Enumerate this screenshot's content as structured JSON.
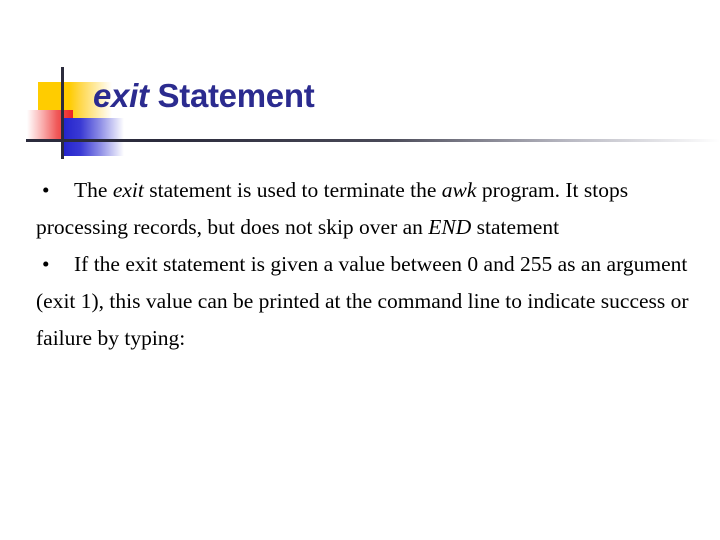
{
  "slide": {
    "background_color": "#ffffff",
    "title": {
      "keyword": "exit",
      "rest": " Statement",
      "color": "#2b2b8f"
    },
    "decoration": {
      "yellow_square_color": "#ffcc00",
      "red_square_color": "#ee2222",
      "blue_square_color": "#2222cc",
      "rule_color": "#2b2b3c"
    },
    "bullets": [
      {
        "marker": "•",
        "segments": [
          {
            "text": "The ",
            "style": "normal"
          },
          {
            "text": "exit",
            "style": "italic"
          },
          {
            "text": " statement is used to terminate the ",
            "style": "normal"
          },
          {
            "text": "awk",
            "style": "italic"
          },
          {
            "text": " program. It stops processing records, but does not skip over an ",
            "style": "normal"
          },
          {
            "text": "END",
            "style": "italic"
          },
          {
            "text": " statement",
            "style": "normal"
          }
        ],
        "plain_text": "The exit statement is used to terminate the awk program. It stops processing records, but does not skip over an END statement"
      },
      {
        "marker": "•",
        "segments": [
          {
            "text": "If the exit statement is given a value between 0 and 255 as an argument (exit 1), this value can be printed at the command line to indicate success or failure by typing:",
            "style": "normal"
          }
        ],
        "plain_text": "If the exit statement is given a value between 0 and 255 as an argument (exit 1), this value can be printed at the command line to indicate success or failure by typing:"
      }
    ]
  }
}
